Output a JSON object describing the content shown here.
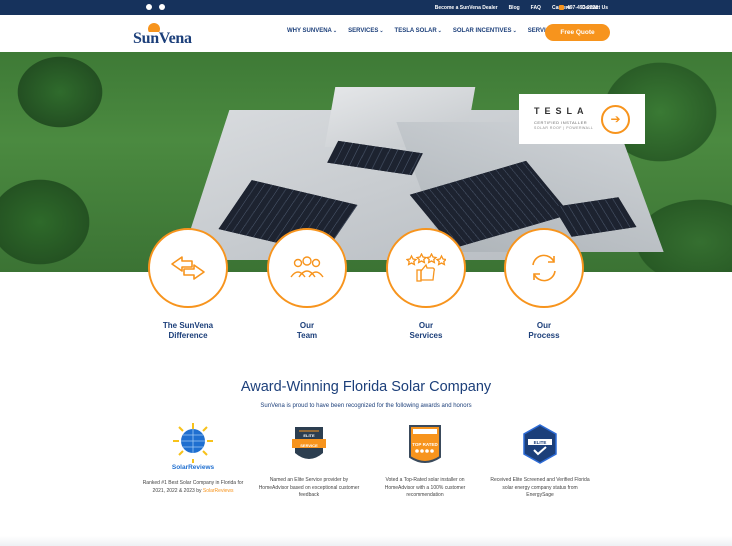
{
  "topbar": {
    "social_icons": [
      "facebook-icon",
      "instagram-icon"
    ],
    "links": [
      "Become a SunVena Dealer",
      "Blog",
      "FAQ",
      "Careers",
      "Contact Us"
    ],
    "phone": "497-493-2328"
  },
  "nav": {
    "logo_text": "SunVena",
    "menu": [
      {
        "label": "WHY SUNVENA",
        "has_dropdown": true
      },
      {
        "label": "SERVICES",
        "has_dropdown": true
      },
      {
        "label": "TESLA SOLAR",
        "has_dropdown": true
      },
      {
        "label": "SOLAR INCENTIVES",
        "has_dropdown": true
      },
      {
        "label": "SERVICE AREA",
        "has_dropdown": false
      }
    ],
    "cta": "Free Quote"
  },
  "hero": {
    "badge_brand": "TESLA",
    "badge_line1": "CERTIFIED INSTALLER",
    "badge_line2": "SOLAR ROOF | POWERWALL",
    "badge_icon": "arrow-right-icon"
  },
  "features": [
    {
      "line1": "The SunVena",
      "line2": "Difference",
      "icon": "arrows-exchange-icon"
    },
    {
      "line1": "Our",
      "line2": "Team",
      "icon": "team-icon"
    },
    {
      "line1": "Our",
      "line2": "Services",
      "icon": "thumbs-up-stars-icon"
    },
    {
      "line1": "Our",
      "line2": "Process",
      "icon": "refresh-cycle-icon"
    }
  ],
  "awards": {
    "title": "Award-Winning Florida Solar Company",
    "subtitle": "SunVena is proud to have been recognized for the following awards and honors",
    "items": [
      {
        "logo_text": "SolarReviews",
        "text": "Ranked #1 Best Solar Company in Florida for 2021, 2022 & 2023 by",
        "highlight": "SolarReviews"
      },
      {
        "logo_text": "ELITE SERVICE",
        "text": "Named an Elite Service provider by HomeAdvisor based on exceptional customer feedback",
        "highlight": ""
      },
      {
        "logo_text": "TOP RATED",
        "text": "Voted a Top-Rated solar installer on HomeAdvisor with a 100% customer recommendation",
        "highlight": ""
      },
      {
        "logo_text": "ELITE",
        "text": "Received Elite Screened and Verified Florida solar energy company status from EnergySage",
        "highlight": ""
      }
    ]
  },
  "colors": {
    "navy": "#16325c",
    "brand_blue": "#1c3f7a",
    "orange": "#f7941d"
  }
}
